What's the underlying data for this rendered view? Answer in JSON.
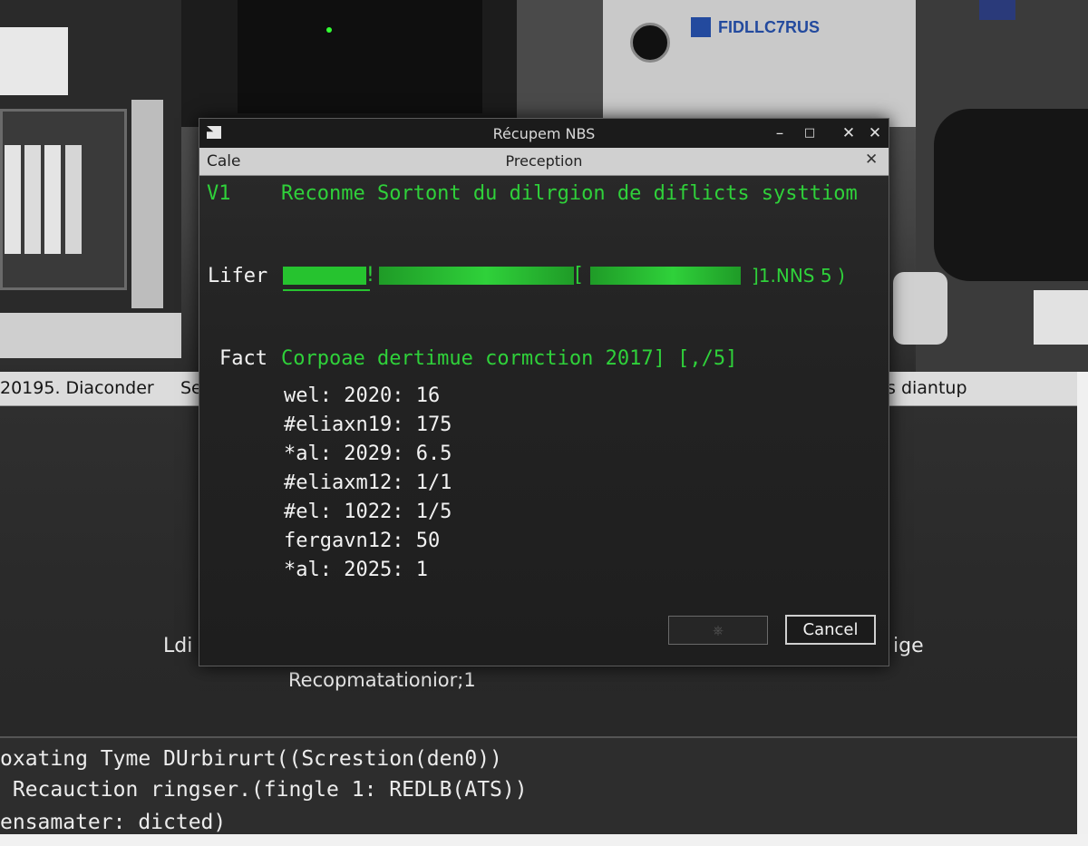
{
  "photo": {
    "brand_logo": "FIDLLC7RUS"
  },
  "background_app": {
    "header_left": "20195. Diaconder",
    "header_mid": "Se",
    "header_right": "s diantup",
    "left_fragment": "Ldi",
    "right_fragment": "ige",
    "status_line": "Recopmatationior;1",
    "console": [
      "oxating Tyme DUrbirurt((Screstion(den0))",
      " Recauction ringser.(fingle 1: REDLB(ATS))",
      "ensamater: dicted)"
    ]
  },
  "dialog": {
    "title": "Récupem NBS",
    "subtitle_left": "Cale",
    "subtitle_center": "Preception",
    "row1_label": "V1",
    "row1_text": "Reconme Sortont du dilrgion de diflicts systtiom",
    "progress_label": "Lifer",
    "progress_value_text": "]1.NNS 5 )",
    "fact_label": "Fact",
    "fact_text": "Corpoae dertimue cormction 2017] [,/5]",
    "facts": [
      "wel: 2020: 16",
      "#eliaxn19: 175",
      "*al: 2029: 6.5",
      "#eliaxm12: 1/1",
      "#el: 1022: 1/5",
      "fergavn12: 50",
      "*al: 2025: 1"
    ],
    "ok_label": "⎈",
    "cancel_label": "Cancel"
  },
  "colors": {
    "accent_green": "#2fd13a",
    "dialog_bg": "#232323"
  }
}
